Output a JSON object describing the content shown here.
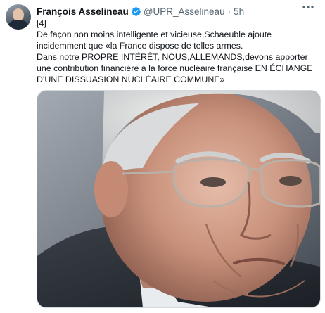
{
  "tweet": {
    "author_name": "François Asselineau",
    "handle": "@UPR_Asselineau",
    "separator": "·",
    "time": "5h",
    "more_icon": "more-dots-icon",
    "verified_icon": "verified-badge-icon",
    "lines": [
      "[4]",
      "De façon non moins intelligente et vicieuse,Schaeuble ajoute incidemment que «la France dispose de telles armes.",
      "Dans notre PROPRE INTÉRÊT, NOUS,ALLEMANDS,devons apporter une contribution financière à la force nucléaire française EN ÉCHANGE D'UNE DISSUASION NUCLÉAIRE COMMUNE»"
    ]
  },
  "colors": {
    "text_primary": "#0f1419",
    "text_secondary": "#536471",
    "verified_blue": "#1d9bf0",
    "border": "#cfd9de"
  }
}
